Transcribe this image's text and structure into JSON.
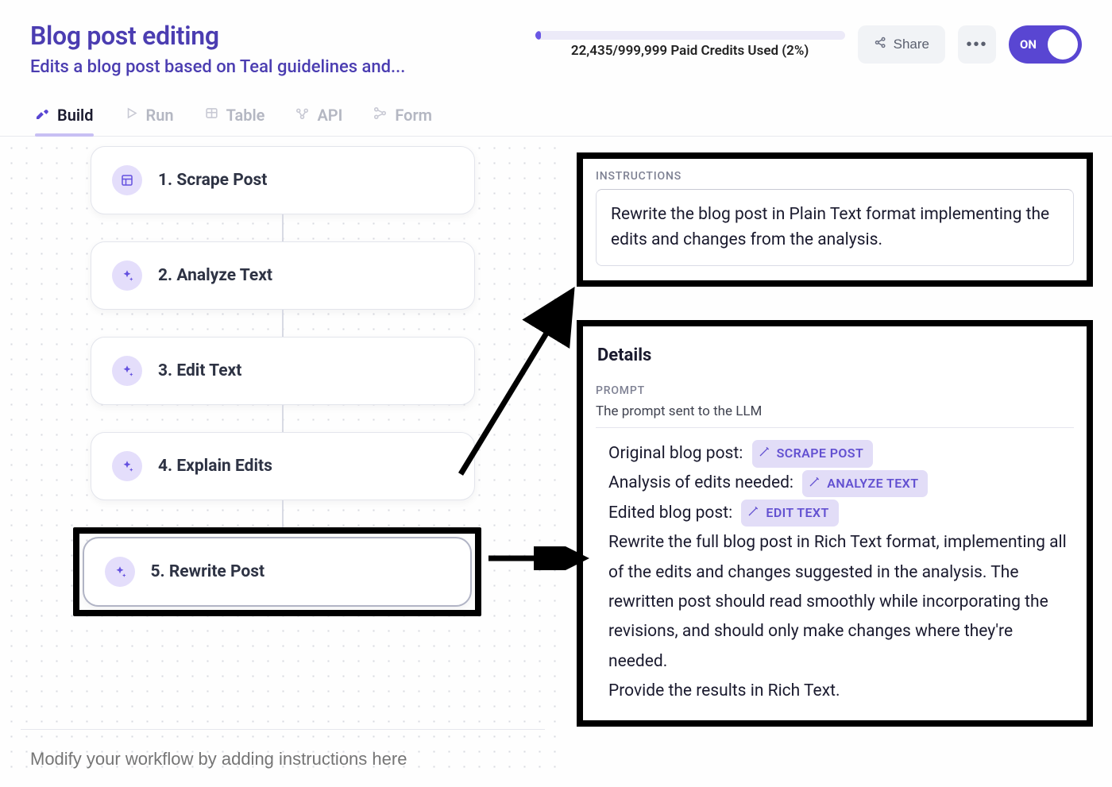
{
  "header": {
    "title": "Blog post editing",
    "subtitle": "Edits a blog post based on Teal guidelines and...",
    "credits_label": "22,435/999,999 Paid Credits Used (2%)",
    "progress_pct": 2,
    "share_label": "Share",
    "toggle_label": "ON"
  },
  "tabs": [
    {
      "label": "Build",
      "active": true
    },
    {
      "label": "Run",
      "active": false
    },
    {
      "label": "Table",
      "active": false
    },
    {
      "label": "API",
      "active": false
    },
    {
      "label": "Form",
      "active": false
    }
  ],
  "steps": [
    {
      "label": "1. Scrape Post",
      "icon": "layout"
    },
    {
      "label": "2. Analyze Text",
      "icon": "sparkle"
    },
    {
      "label": "3. Edit Text",
      "icon": "sparkle"
    },
    {
      "label": "4. Explain Edits",
      "icon": "sparkle"
    },
    {
      "label": "5. Rewrite Post",
      "icon": "sparkle",
      "highlighted": true
    }
  ],
  "instruction_input_placeholder": "Modify your workflow by adding instructions here",
  "panel_instructions": {
    "heading": "INSTRUCTIONS",
    "text": "Rewrite the blog post in Plain Text format implementing the edits and changes from the analysis."
  },
  "panel_details": {
    "title": "Details",
    "prompt_heading": "PROMPT",
    "prompt_desc": "The prompt sent to the LLM",
    "lines": [
      {
        "prefix": "Original blog post:",
        "chip": "SCRAPE POST"
      },
      {
        "prefix": "Analysis of edits needed:",
        "chip": "ANALYZE TEXT"
      },
      {
        "prefix": "Edited blog post:",
        "chip": "EDIT TEXT"
      }
    ],
    "body": "Rewrite the full blog post in Rich Text format, implementing all of the edits and changes suggested in the analysis. The rewritten post should read smoothly while incorporating the revisions, and should only make changes where they're needed.",
    "body2": "Provide the results in Rich Text."
  }
}
